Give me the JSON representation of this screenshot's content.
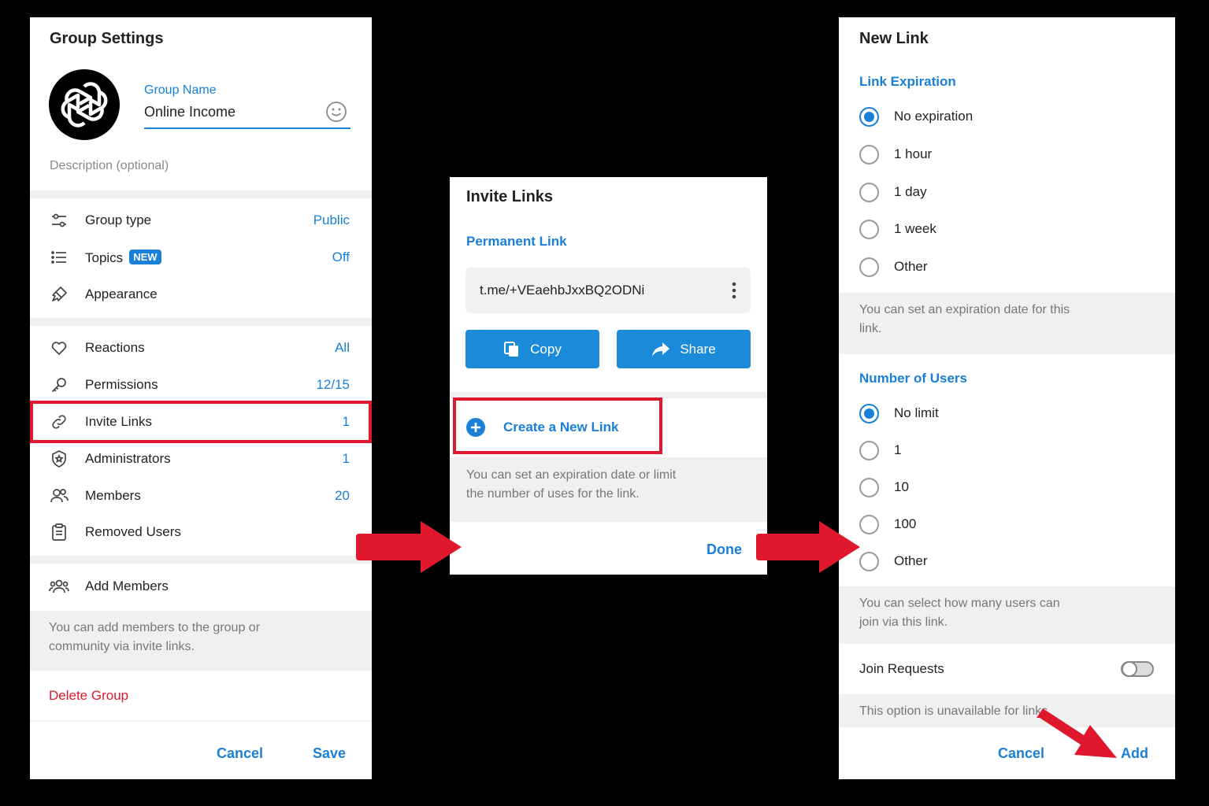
{
  "group_settings": {
    "title": "Group Settings",
    "group_name_label": "Group Name",
    "group_name_value": "Online Income",
    "description_placeholder": "Description (optional)",
    "rows_a": [
      {
        "icon": "sliders-icon",
        "label": "Group type",
        "value": "Public"
      },
      {
        "icon": "list-icon",
        "label": "Topics",
        "badge": "NEW",
        "value": "Off"
      },
      {
        "icon": "brush-icon",
        "label": "Appearance",
        "value": ""
      }
    ],
    "rows_b": [
      {
        "icon": "heart-icon",
        "label": "Reactions",
        "value": "All"
      },
      {
        "icon": "key-icon",
        "label": "Permissions",
        "value": "12/15"
      },
      {
        "icon": "link-icon",
        "label": "Invite Links",
        "value": "1"
      },
      {
        "icon": "shield-star-icon",
        "label": "Administrators",
        "value": "1"
      },
      {
        "icon": "users-icon",
        "label": "Members",
        "value": "20"
      },
      {
        "icon": "clipboard-icon",
        "label": "Removed Users",
        "value": ""
      }
    ],
    "add_members_label": "Add Members",
    "add_members_note": "You can add members to the group or community via invite links.",
    "delete_label": "Delete Group",
    "cancel_label": "Cancel",
    "save_label": "Save"
  },
  "invite_links": {
    "title": "Invite Links",
    "permanent_link_title": "Permanent Link",
    "link_value": "t.me/+VEaehbJxxBQ2ODNi",
    "copy_label": "Copy",
    "share_label": "Share",
    "create_label": "Create a New Link",
    "note": "You can set an expiration date or limit the number of uses for the link.",
    "done_label": "Done"
  },
  "new_link": {
    "title": "New Link",
    "expiration_title": "Link Expiration",
    "expiration_options": [
      "No expiration",
      "1 hour",
      "1 day",
      "1 week",
      "Other"
    ],
    "expiration_selected": 0,
    "expiration_note": "You can set an expiration date for this link.",
    "users_title": "Number of Users",
    "users_options": [
      "No limit",
      "1",
      "10",
      "100",
      "Other"
    ],
    "users_selected": 0,
    "users_note": "You can select how many users can join via this link.",
    "join_requests_label": "Join Requests",
    "join_requests_enabled": false,
    "join_requests_note": "This option is unavailable for links.",
    "cancel_label": "Cancel",
    "add_label": "Add"
  },
  "colors": {
    "accent": "#1a7fd6",
    "highlight": "#e0182d",
    "danger": "#e0182d"
  }
}
